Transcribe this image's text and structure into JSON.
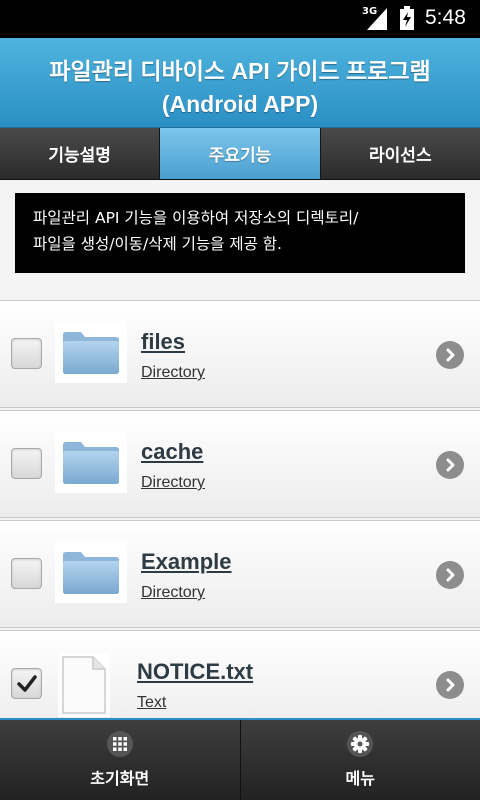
{
  "status_bar": {
    "network": "3G",
    "time": "5:48"
  },
  "header": {
    "title_line1": "파일관리 디바이스 API 가이드 프로그램",
    "title_line2": "(Android APP)"
  },
  "tabs": [
    {
      "label": "기능설명",
      "active": false
    },
    {
      "label": "주요기능",
      "active": true
    },
    {
      "label": "라이선스",
      "active": false
    }
  ],
  "description": {
    "line1": "파일관리 API 기능을 이용하여 저장소의 디렉토리/",
    "line2": "파일을 생성/이동/삭제 기능을 제공 함."
  },
  "items": [
    {
      "name": "files",
      "type": "Directory",
      "checked": false,
      "icon": "folder-icon"
    },
    {
      "name": "cache",
      "type": "Directory",
      "checked": false,
      "icon": "folder-icon"
    },
    {
      "name": "Example",
      "type": "Directory",
      "checked": false,
      "icon": "folder-icon"
    },
    {
      "name": "NOTICE.txt",
      "type": "Text",
      "checked": true,
      "icon": "document-icon"
    }
  ],
  "bottom_bar": {
    "home_label": "초기화면",
    "menu_label": "메뉴"
  },
  "colors": {
    "accent": "#2a8fc4",
    "active_tab": "#7cc6ec"
  }
}
